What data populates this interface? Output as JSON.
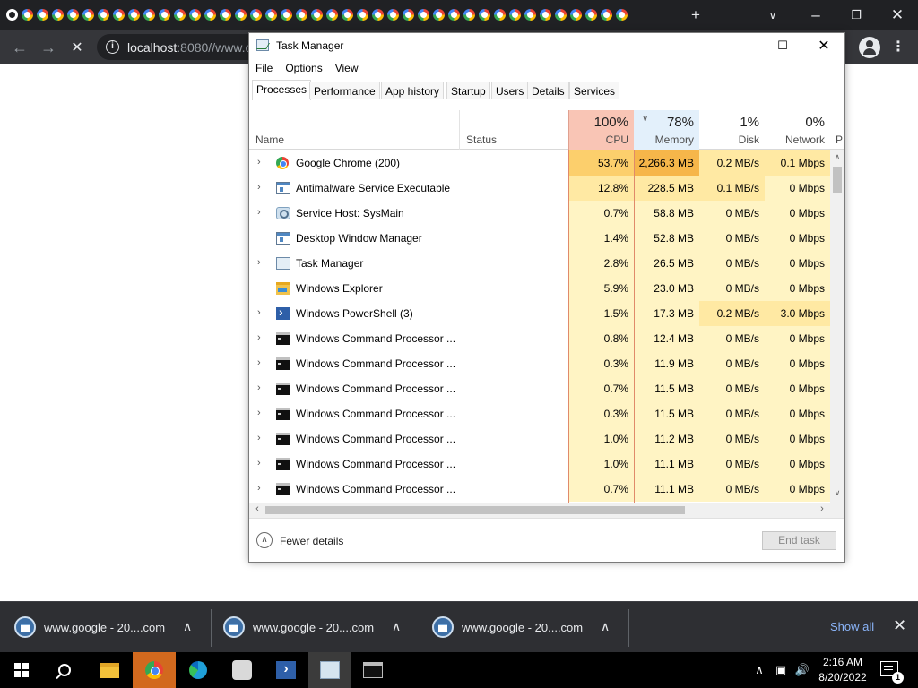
{
  "browser": {
    "url_host": "localhost",
    "url_rest": ":8080//www.c",
    "mini_tab_count": 41
  },
  "taskmanager": {
    "title": "Task Manager",
    "menu": [
      "File",
      "Options",
      "View"
    ],
    "tabs": [
      "Processes",
      "Performance",
      "App history",
      "Startup",
      "Users",
      "Details",
      "Services"
    ],
    "active_tab": "Processes",
    "header": {
      "name": "Name",
      "status": "Status",
      "cpu_pct": "100%",
      "cpu": "CPU",
      "mem_pct": "78%",
      "mem": "Memory",
      "disk_pct": "1%",
      "disk": "Disk",
      "net_pct": "0%",
      "net": "Network",
      "power_cut": "P"
    },
    "processes": [
      {
        "name": "Google Chrome (200)",
        "icon": "chrome-icon",
        "expandable": true,
        "cpu": "53.7%",
        "mem": "2,266.3 MB",
        "disk": "0.2 MB/s",
        "net": "0.1 Mbps"
      },
      {
        "name": "Antimalware Service Executable",
        "icon": "window-app-icon",
        "expandable": true,
        "cpu": "12.8%",
        "mem": "228.5 MB",
        "disk": "0.1 MB/s",
        "net": "0 Mbps"
      },
      {
        "name": "Service Host: SysMain",
        "icon": "gear-icon",
        "expandable": true,
        "cpu": "0.7%",
        "mem": "58.8 MB",
        "disk": "0 MB/s",
        "net": "0 Mbps"
      },
      {
        "name": "Desktop Window Manager",
        "icon": "window-app-icon",
        "expandable": false,
        "cpu": "1.4%",
        "mem": "52.8 MB",
        "disk": "0 MB/s",
        "net": "0 Mbps"
      },
      {
        "name": "Task Manager",
        "icon": "task-manager-icon",
        "expandable": true,
        "cpu": "2.8%",
        "mem": "26.5 MB",
        "disk": "0 MB/s",
        "net": "0 Mbps"
      },
      {
        "name": "Windows Explorer",
        "icon": "folder-icon",
        "expandable": false,
        "cpu": "5.9%",
        "mem": "23.0 MB",
        "disk": "0 MB/s",
        "net": "0 Mbps"
      },
      {
        "name": "Windows PowerShell (3)",
        "icon": "powershell-icon",
        "expandable": true,
        "cpu": "1.5%",
        "mem": "17.3 MB",
        "disk": "0.2 MB/s",
        "net": "3.0 Mbps"
      },
      {
        "name": "Windows Command Processor ...",
        "icon": "cmd-icon",
        "expandable": true,
        "cpu": "0.8%",
        "mem": "12.4 MB",
        "disk": "0 MB/s",
        "net": "0 Mbps"
      },
      {
        "name": "Windows Command Processor ...",
        "icon": "cmd-icon",
        "expandable": true,
        "cpu": "0.3%",
        "mem": "11.9 MB",
        "disk": "0 MB/s",
        "net": "0 Mbps"
      },
      {
        "name": "Windows Command Processor ...",
        "icon": "cmd-icon",
        "expandable": true,
        "cpu": "0.7%",
        "mem": "11.5 MB",
        "disk": "0 MB/s",
        "net": "0 Mbps"
      },
      {
        "name": "Windows Command Processor ...",
        "icon": "cmd-icon",
        "expandable": true,
        "cpu": "0.3%",
        "mem": "11.5 MB",
        "disk": "0 MB/s",
        "net": "0 Mbps"
      },
      {
        "name": "Windows Command Processor ...",
        "icon": "cmd-icon",
        "expandable": true,
        "cpu": "1.0%",
        "mem": "11.2 MB",
        "disk": "0 MB/s",
        "net": "0 Mbps"
      },
      {
        "name": "Windows Command Processor ...",
        "icon": "cmd-icon",
        "expandable": true,
        "cpu": "1.0%",
        "mem": "11.1 MB",
        "disk": "0 MB/s",
        "net": "0 Mbps"
      },
      {
        "name": "Windows Command Processor ...",
        "icon": "cmd-icon",
        "expandable": true,
        "cpu": "0.7%",
        "mem": "11.1 MB",
        "disk": "0 MB/s",
        "net": "0 Mbps"
      }
    ],
    "fewer_details": "Fewer details",
    "end_task": "End task"
  },
  "downloads": {
    "items": [
      "www.google - 20....com",
      "www.google - 20....com",
      "www.google - 20....com"
    ],
    "show_all": "Show all"
  },
  "taskbar": {
    "time": "2:16 AM",
    "date": "8/20/2022",
    "notifications": "1"
  },
  "colors": {
    "cpu_header": "#f9c5b5",
    "cpu_hot": "#fccf6c",
    "mem_hot": "#f6b64a",
    "cell_light": "#fff4c4",
    "cell_mid": "#ffe9a3",
    "mem_header": "#e3f0fb",
    "chrome_dark": "#202124",
    "downloads_bg": "#2e2f33"
  }
}
